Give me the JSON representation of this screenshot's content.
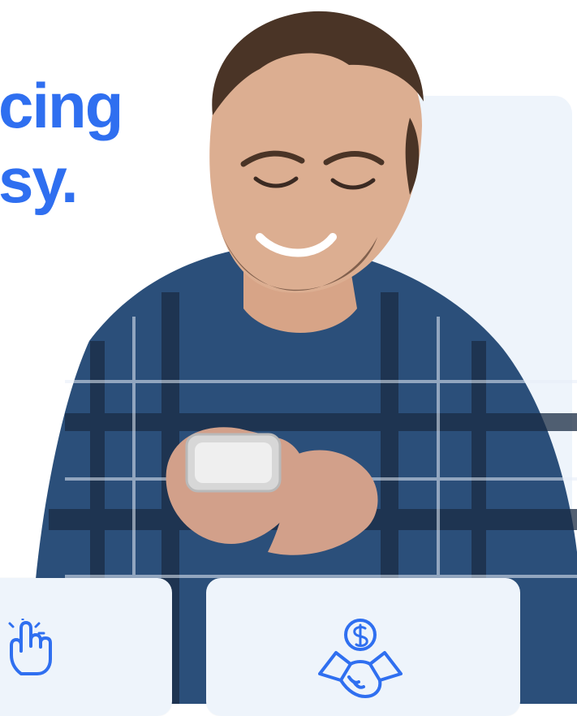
{
  "headline": {
    "line1": "cing",
    "line2": "sy."
  },
  "colors": {
    "accent": "#2f6ff0",
    "panel_bg": "#eef4fb"
  },
  "cards": [
    {
      "icon": "pointer-click-icon"
    },
    {
      "icon": "money-handshake-icon"
    }
  ]
}
